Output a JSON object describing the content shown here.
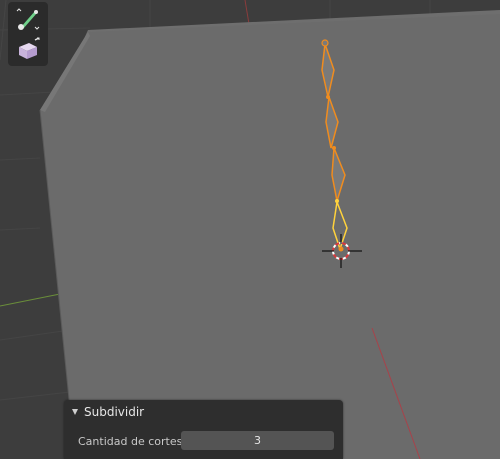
{
  "toolbar": {
    "tools": [
      {
        "icon": "bone-envelope-icon"
      },
      {
        "icon": "extrude-cube-icon"
      }
    ]
  },
  "operator_panel": {
    "title": "Subdividir",
    "fields": [
      {
        "label": "Cantidad de cortes",
        "value": "3"
      }
    ]
  },
  "colors": {
    "grid_background": "#3d3d3d",
    "mesh_face": "#6b6b6b",
    "bone_selected": "#f08c1e",
    "bone_active": "#ffd23c",
    "panel_bg": "#2e2e2e"
  }
}
